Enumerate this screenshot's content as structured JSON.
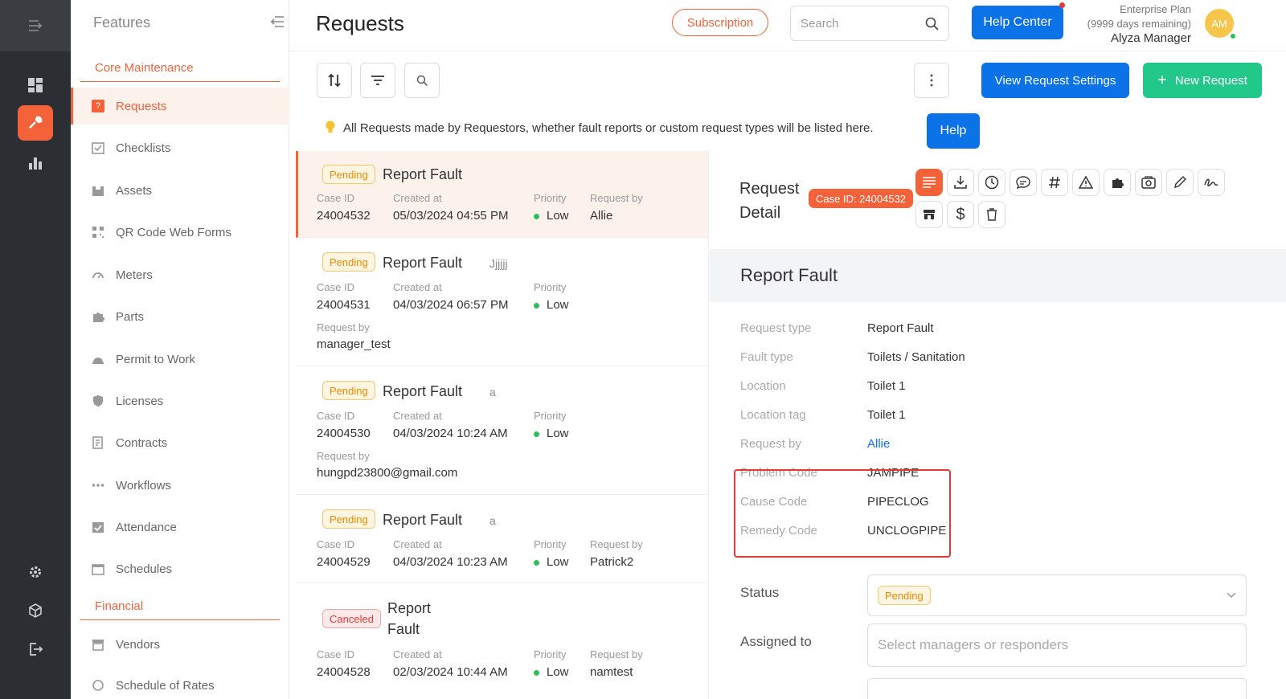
{
  "rail": {
    "items": [
      "menu-toggle",
      "dashboard",
      "requests",
      "analytics",
      "settings",
      "modules",
      "logout"
    ]
  },
  "sidebar": {
    "title": "Features",
    "sections": [
      {
        "label": "Core Maintenance"
      },
      {
        "label": "Financial"
      }
    ],
    "items": [
      {
        "label": "Requests",
        "active": true
      },
      {
        "label": "Checklists"
      },
      {
        "label": "Assets"
      },
      {
        "label": "QR Code Web Forms"
      },
      {
        "label": "Meters"
      },
      {
        "label": "Parts"
      },
      {
        "label": "Permit to Work"
      },
      {
        "label": "Licenses"
      },
      {
        "label": "Contracts"
      },
      {
        "label": "Workflows"
      },
      {
        "label": "Attendance"
      },
      {
        "label": "Schedules"
      },
      {
        "label": "Vendors"
      },
      {
        "label": "Schedule of Rates"
      }
    ]
  },
  "header": {
    "title": "Requests",
    "subscription_label": "Subscription",
    "search_placeholder": "Search",
    "help_center_label": "Help Center",
    "plan_name": "Enterprise Plan",
    "plan_remaining": "(9999 days remaining)",
    "user_name": "Alyza Manager",
    "avatar_initials": "AM"
  },
  "toolbar": {
    "view_settings_label": "View Request Settings",
    "new_request_label": "New Request",
    "info_text": "All Requests made by Requestors, whether fault reports or custom request types will be listed here.",
    "help_label": "Help"
  },
  "list_labels": {
    "case_id": "Case ID",
    "created_at": "Created at",
    "priority": "Priority",
    "request_by": "Request by"
  },
  "requests": [
    {
      "status": "Pending",
      "title": "Report Fault",
      "extra": "",
      "case_id": "24004532",
      "created_at": "05/03/2024 04:55 PM",
      "priority": "Low",
      "request_by": "Allie"
    },
    {
      "status": "Pending",
      "title": "Report Fault",
      "extra": "Jjjjjj",
      "case_id": "24004531",
      "created_at": "04/03/2024 06:57 PM",
      "priority": "Low",
      "request_by": "manager_test"
    },
    {
      "status": "Pending",
      "title": "Report Fault",
      "extra": "a",
      "case_id": "24004530",
      "created_at": "04/03/2024 10:24 AM",
      "priority": "Low",
      "request_by": "hungpd23800@gmail.com"
    },
    {
      "status": "Pending",
      "title": "Report Fault",
      "extra": "a",
      "case_id": "24004529",
      "created_at": "04/03/2024 10:23 AM",
      "priority": "Low",
      "request_by": "Patrick2"
    },
    {
      "status": "Canceled",
      "title_line1": "Report",
      "title_line2": "Fault",
      "case_id": "24004528",
      "created_at": "02/03/2024 10:44 AM",
      "priority": "Low",
      "request_by": "namtest"
    }
  ],
  "detail": {
    "heading_line1": "Request",
    "heading_line2": "Detail",
    "case_badge": "Case ID: 24004532",
    "band_title": "Report Fault",
    "action_icons": [
      "details",
      "download",
      "history",
      "comments",
      "tags",
      "warning",
      "parts",
      "photo",
      "edit",
      "signature",
      "store",
      "cost",
      "delete"
    ],
    "fields": [
      {
        "key": "Request type",
        "value": "Report Fault"
      },
      {
        "key": "Fault type",
        "value": "Toilets / Sanitation"
      },
      {
        "key": "Location",
        "value": "Toilet 1"
      },
      {
        "key": "Location tag",
        "value": "Toilet 1"
      },
      {
        "key": "Request by",
        "value": "Allie"
      },
      {
        "key": "Problem Code",
        "value": "JAMPIPE"
      },
      {
        "key": "Cause Code",
        "value": "PIPECLOG"
      },
      {
        "key": "Remedy Code",
        "value": "UNCLOGPIPE"
      }
    ],
    "status_label": "Status",
    "status_value": "Pending",
    "assigned_label": "Assigned to",
    "assigned_placeholder": "Select managers or responders"
  },
  "colors": {
    "accent": "#f4623a",
    "primary": "#0b72e7",
    "success": "#22c88a",
    "rail": "#2b2e33"
  }
}
